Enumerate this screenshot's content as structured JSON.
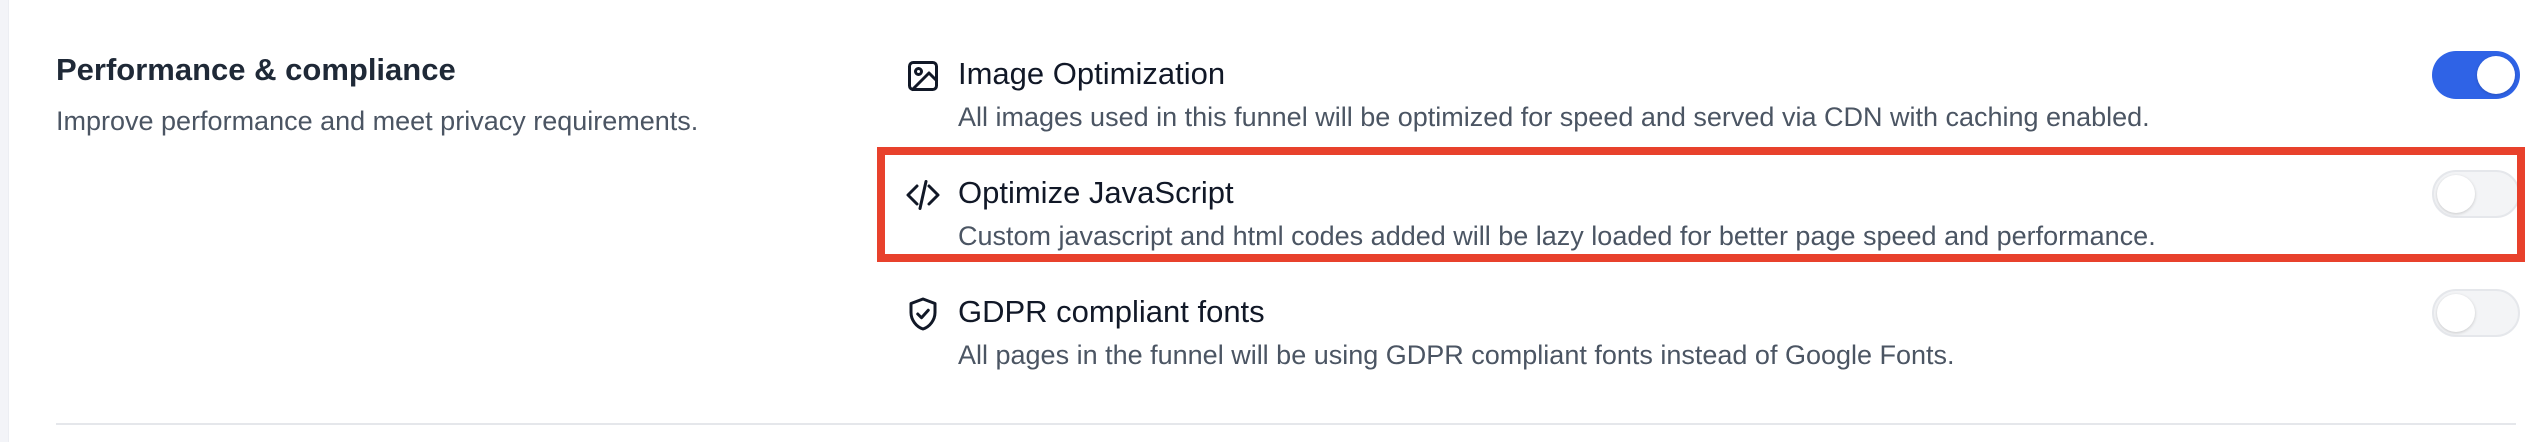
{
  "section": {
    "title": "Performance & compliance",
    "description": "Improve performance and meet privacy requirements."
  },
  "settings": [
    {
      "icon": "image-icon",
      "label": "Image Optimization",
      "description": "All images used in this funnel will be optimized for speed and served via CDN with caching enabled.",
      "enabled": true
    },
    {
      "icon": "code-icon",
      "label": "Optimize JavaScript",
      "description": "Custom javascript and html codes added will be lazy loaded for better page speed and performance.",
      "enabled": false
    },
    {
      "icon": "shield-check-icon",
      "label": "GDPR compliant fonts",
      "description": "All pages in the funnel will be using GDPR compliant fonts instead of Google Fonts.",
      "enabled": false
    }
  ],
  "colors": {
    "toggle_on": "#2f63e6",
    "highlight": "#e8412c"
  }
}
